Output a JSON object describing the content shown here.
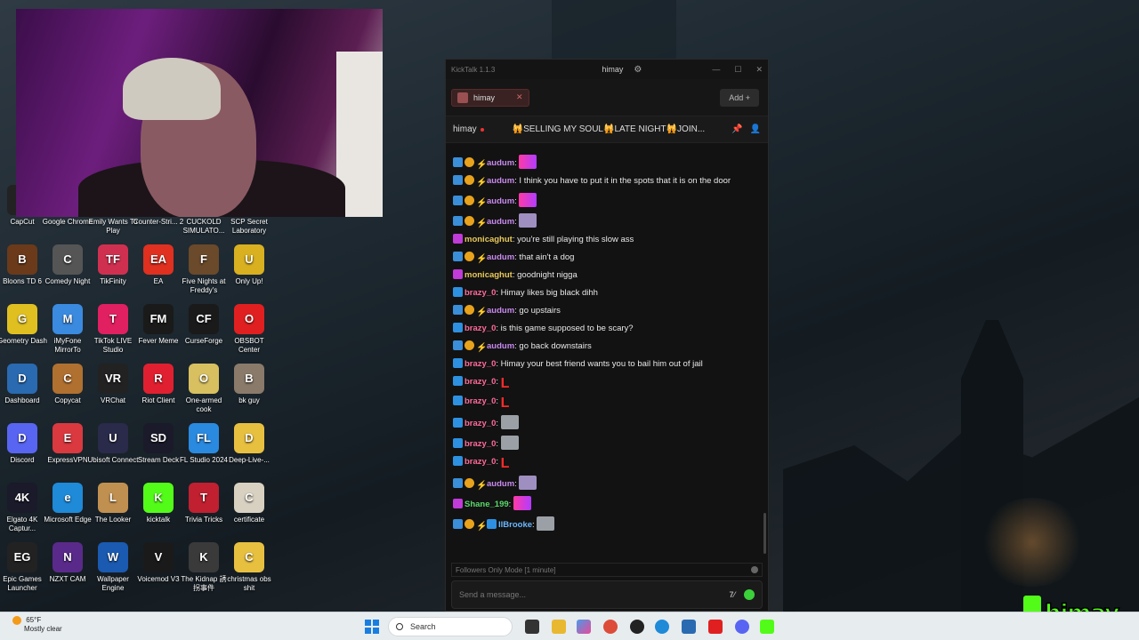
{
  "desktop_icons": [
    {
      "label": "CapCut",
      "color": "#222222",
      "glyph": "C"
    },
    {
      "label": "Google Chrome",
      "color": "#dd4b39",
      "glyph": "G"
    },
    {
      "label": "Emily Wants To Play",
      "color": "#5a3a2a",
      "glyph": "E"
    },
    {
      "label": "Counter-Stri... 2",
      "color": "#e8a020",
      "glyph": "CS"
    },
    {
      "label": "CUCKOLD SIMULATO...",
      "color": "#7a2a2a",
      "glyph": "C"
    },
    {
      "label": "SCP Secret Laboratory",
      "color": "#333333",
      "glyph": "S"
    },
    {
      "label": "Bloons TD 6",
      "color": "#6a3a1a",
      "glyph": "B"
    },
    {
      "label": "Comedy Night",
      "color": "#555555",
      "glyph": "C"
    },
    {
      "label": "TikFinity",
      "color": "#d03050",
      "glyph": "TF"
    },
    {
      "label": "EA",
      "color": "#e03020",
      "glyph": "EA"
    },
    {
      "label": "Five Nights at Freddy's",
      "color": "#6a4a2a",
      "glyph": "F"
    },
    {
      "label": "Only Up!",
      "color": "#d8b020",
      "glyph": "U"
    },
    {
      "label": "Geometry Dash",
      "color": "#e0c020",
      "glyph": "G"
    },
    {
      "label": "iMyFone MirrorTo",
      "color": "#3a8ae0",
      "glyph": "M"
    },
    {
      "label": "TikTok LIVE Studio",
      "color": "#e02060",
      "glyph": "T"
    },
    {
      "label": "Fever Meme",
      "color": "#1a1a1a",
      "glyph": "FM"
    },
    {
      "label": "CurseForge",
      "color": "#1a1a1a",
      "glyph": "CF"
    },
    {
      "label": "OBSBOT Center",
      "color": "#e02020",
      "glyph": "O"
    },
    {
      "label": "Dashboard",
      "color": "#2a6ab0",
      "glyph": "D"
    },
    {
      "label": "Copycat",
      "color": "#b07030",
      "glyph": "C"
    },
    {
      "label": "VRChat",
      "color": "#222222",
      "glyph": "VR"
    },
    {
      "label": "Riot Client",
      "color": "#e02030",
      "glyph": "R"
    },
    {
      "label": "One-armed cook",
      "color": "#d8c060",
      "glyph": "O"
    },
    {
      "label": "bk guy",
      "color": "#8a7a6a",
      "glyph": "B"
    },
    {
      "label": "Discord",
      "color": "#5865f2",
      "glyph": "D"
    },
    {
      "label": "ExpressVPN",
      "color": "#da3940",
      "glyph": "E"
    },
    {
      "label": "Ubisoft Connect",
      "color": "#2a2a4a",
      "glyph": "U"
    },
    {
      "label": "Stream Deck",
      "color": "#1a1a2a",
      "glyph": "SD"
    },
    {
      "label": "FL Studio 2024",
      "color": "#2a8ae0",
      "glyph": "FL"
    },
    {
      "label": "Deep-Live-...",
      "color": "#e8c040",
      "glyph": "D"
    },
    {
      "label": "Elgato 4K Captur...",
      "color": "#1a1a2a",
      "glyph": "4K"
    },
    {
      "label": "Microsoft Edge",
      "color": "#1e8ad8",
      "glyph": "e"
    },
    {
      "label": "The Looker",
      "color": "#c09050",
      "glyph": "L"
    },
    {
      "label": "kicktalk",
      "color": "#53fc18",
      "glyph": "K"
    },
    {
      "label": "Trivia Tricks",
      "color": "#c02030",
      "glyph": "T"
    },
    {
      "label": "certificate",
      "color": "#d8d0c0",
      "glyph": "C"
    },
    {
      "label": "Epic Games Launcher",
      "color": "#222222",
      "glyph": "EG"
    },
    {
      "label": "NZXT CAM",
      "color": "#5a2a8a",
      "glyph": "N"
    },
    {
      "label": "Wallpaper Engine",
      "color": "#1a5ab0",
      "glyph": "W"
    },
    {
      "label": "Voicemod V3",
      "color": "#1a1a1a",
      "glyph": "V"
    },
    {
      "label": "The Kidnap 誘拐事件",
      "color": "#3a3a3a",
      "glyph": "K"
    },
    {
      "label": "christmas obs shit",
      "color": "#e8c040",
      "glyph": "C"
    }
  ],
  "kicktalk": {
    "app_title": "KickTalk 1.1.3",
    "current_channel": "himay",
    "tab_label": "himay",
    "add_label": "Add +",
    "stream_name": "himay",
    "stream_title": "🙀SELLING MY SOUL🙀LATE NIGHT🙀JOIN...",
    "followers_mode": "Followers Only Mode [1 minute]",
    "input_placeholder": "Send a message...",
    "messages": [
      {
        "badges": [
          "blue",
          "gold",
          "red"
        ],
        "user": "audum",
        "color": "#c98af0",
        "text": "",
        "emote": "ramp"
      },
      {
        "badges": [
          "blue",
          "gold",
          "red"
        ],
        "user": "audum",
        "color": "#c98af0",
        "text": "I think you have to put it in the spots that it is on the door",
        "emote": ""
      },
      {
        "badges": [
          "blue",
          "gold",
          "red"
        ],
        "user": "audum",
        "color": "#c98af0",
        "text": "",
        "emote": "ramp"
      },
      {
        "badges": [
          "blue",
          "gold",
          "red"
        ],
        "user": "audum",
        "color": "#c98af0",
        "text": "",
        "emote": "bald"
      },
      {
        "badges": [
          "pink"
        ],
        "user": "monicaghut",
        "color": "#e8c95a",
        "text": "you're still playing this slow ass",
        "emote": ""
      },
      {
        "badges": [
          "blue",
          "gold",
          "red"
        ],
        "user": "audum",
        "color": "#c98af0",
        "text": "that ain't a dog",
        "emote": ""
      },
      {
        "badges": [
          "pink"
        ],
        "user": "monicaghut",
        "color": "#e8c95a",
        "text": "goodnight nigga",
        "emote": ""
      },
      {
        "badges": [
          "cube"
        ],
        "user": "brazy_0",
        "color": "#ff6a9a",
        "text": "Himay likes big black dihh",
        "emote": ""
      },
      {
        "badges": [
          "blue",
          "gold",
          "red"
        ],
        "user": "audum",
        "color": "#c98af0",
        "text": "go upstairs",
        "emote": ""
      },
      {
        "badges": [
          "cube"
        ],
        "user": "brazy_0",
        "color": "#ff6a9a",
        "text": "is this game supposed to be scary?",
        "emote": ""
      },
      {
        "badges": [
          "blue",
          "gold",
          "red"
        ],
        "user": "audum",
        "color": "#c98af0",
        "text": "go back downstairs",
        "emote": ""
      },
      {
        "badges": [
          "cube"
        ],
        "user": "brazy_0",
        "color": "#ff6a9a",
        "text": "Himay your best friend wants you to bail him out of jail",
        "emote": ""
      },
      {
        "badges": [
          "cube"
        ],
        "user": "brazy_0",
        "color": "#ff6a9a",
        "text": "",
        "emote": "L"
      },
      {
        "badges": [
          "cube"
        ],
        "user": "brazy_0",
        "color": "#ff6a9a",
        "text": "",
        "emote": "L"
      },
      {
        "badges": [
          "cube"
        ],
        "user": "brazy_0",
        "color": "#ff6a9a",
        "text": "",
        "emote": "face"
      },
      {
        "badges": [
          "cube"
        ],
        "user": "brazy_0",
        "color": "#ff6a9a",
        "text": "",
        "emote": "face"
      },
      {
        "badges": [
          "cube"
        ],
        "user": "brazy_0",
        "color": "#ff6a9a",
        "text": "",
        "emote": "L"
      },
      {
        "badges": [
          "blue",
          "gold",
          "red"
        ],
        "user": "audum",
        "color": "#c98af0",
        "text": "",
        "emote": "bald"
      },
      {
        "badges": [
          "pink"
        ],
        "user": "Shane_199",
        "color": "#5ad86a",
        "text": "",
        "emote": "ramp"
      },
      {
        "badges": [
          "blue",
          "gold",
          "red",
          "cube"
        ],
        "user": "llBrooke",
        "color": "#6ab8ff",
        "text": "",
        "emote": "face"
      }
    ]
  },
  "taskbar": {
    "weather_temp": "65°F",
    "weather_desc": "Mostly clear",
    "search_label": "Search"
  },
  "overlay_logo": "himay"
}
